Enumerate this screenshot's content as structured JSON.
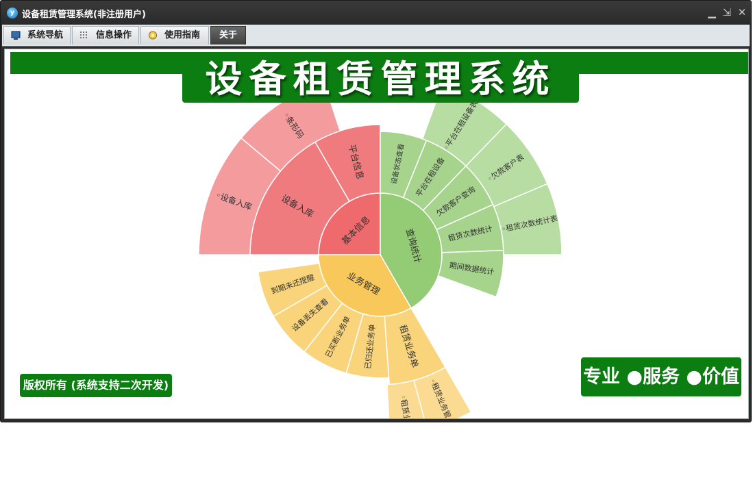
{
  "window": {
    "title": "设备租赁管理系统(非注册用户)",
    "controls": {
      "minimize": "▁",
      "restore": "⇲",
      "close": "✕"
    }
  },
  "tabs": [
    {
      "label": "系统导航",
      "icon": "monitor-icon"
    },
    {
      "label": "信息操作",
      "icon": "grid-icon"
    },
    {
      "label": "使用指南",
      "icon": "guide-icon"
    },
    {
      "label": "关于",
      "icon": "",
      "active": true
    }
  ],
  "banner": {
    "title": "设备租赁管理系统"
  },
  "footer": {
    "copyright": "版权所有 (系统支持二次开发)",
    "slogan": "专业 ●服务 ●价值"
  },
  "colors": {
    "brand_green": "#0b7d11",
    "red": "#f06d70",
    "green": "#94cb75",
    "yellow": "#f8c85a"
  },
  "sunburst": {
    "nodes": [
      {
        "label": "基本信息",
        "level": 1,
        "color": "#ef6a6d"
      },
      {
        "label": "设备入库",
        "level": 2,
        "color": "#f07b7e"
      },
      {
        "label": "平台信息",
        "level": 2,
        "color": "#f07b7e"
      },
      {
        "label": "◦设备入库",
        "level": 3,
        "color": "#f49b9e"
      },
      {
        "label": "◦条形码",
        "level": 3,
        "color": "#f49b9e"
      },
      {
        "label": "查询统计",
        "level": 1,
        "color": "#94cb75"
      },
      {
        "label": "设备状态查看",
        "level": 2,
        "color": "#a6d48c"
      },
      {
        "label": "平台在租设备",
        "level": 2,
        "color": "#a6d48c"
      },
      {
        "label": "欠款客户查询",
        "level": 2,
        "color": "#a6d48c"
      },
      {
        "label": "租赁次数统计",
        "level": 2,
        "color": "#a6d48c"
      },
      {
        "label": "期间数据统计",
        "level": 2,
        "color": "#a6d48c"
      },
      {
        "label": "◦平台在租设备表",
        "level": 3,
        "color": "#b7dda3"
      },
      {
        "label": "◦欠款客户表",
        "level": 3,
        "color": "#b7dda3"
      },
      {
        "label": "◦租赁次数统计表",
        "level": 3,
        "color": "#b7dda3"
      },
      {
        "label": "业务管理",
        "level": 1,
        "color": "#f8c85a"
      },
      {
        "label": "到期未还提醒",
        "level": 2,
        "color": "#f9d47a"
      },
      {
        "label": "设备丢失查看",
        "level": 2,
        "color": "#f9d47a"
      },
      {
        "label": "已买断业务单",
        "level": 2,
        "color": "#f9d47a"
      },
      {
        "label": "已归还业务单",
        "level": 2,
        "color": "#f9d47a"
      },
      {
        "label": "租赁业务单",
        "level": 2,
        "color": "#f9d47a"
      },
      {
        "label": "◦租赁业",
        "level": 3,
        "color": "#fbdb92"
      },
      {
        "label": "◦租赁业务管",
        "level": 3,
        "color": "#fbdb92"
      }
    ]
  }
}
